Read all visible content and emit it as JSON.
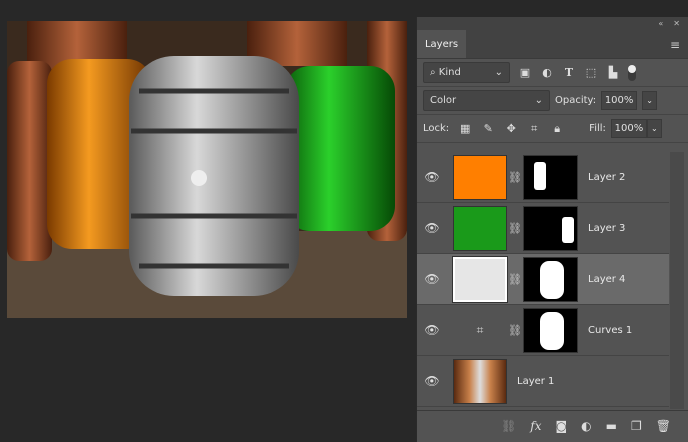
{
  "panel": {
    "title": "Layers",
    "collapse_icon": "«",
    "close_icon": "✕",
    "menu_icon": "≡"
  },
  "filter": {
    "kind": "Kind"
  },
  "blend": {
    "mode": "Color",
    "opacity_label": "Opacity:",
    "opacity": "100%"
  },
  "lock": {
    "label": "Lock:",
    "fill_label": "Fill:",
    "fill": "100%"
  },
  "layers": [
    {
      "name": "Layer 2",
      "color": "#ff7f00"
    },
    {
      "name": "Layer 3",
      "color": "#1a9a1a"
    },
    {
      "name": "Layer 4",
      "color": "#e6e6e6"
    },
    {
      "name": "Curves 1"
    },
    {
      "name": "Layer 1"
    }
  ]
}
